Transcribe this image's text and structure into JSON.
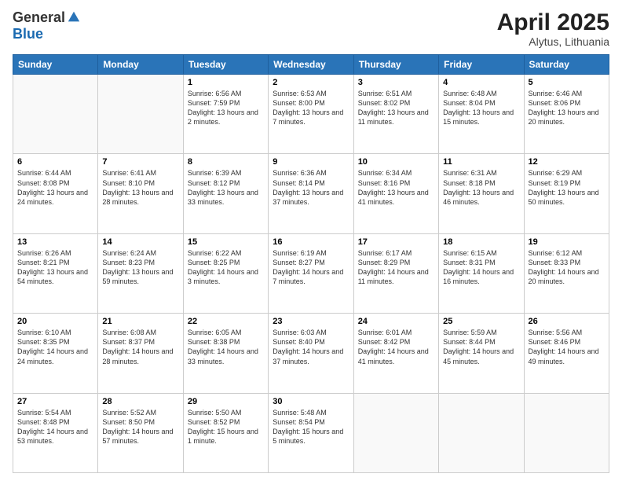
{
  "header": {
    "logo_general": "General",
    "logo_blue": "Blue",
    "title": "April 2025",
    "location": "Alytus, Lithuania"
  },
  "weekdays": [
    "Sunday",
    "Monday",
    "Tuesday",
    "Wednesday",
    "Thursday",
    "Friday",
    "Saturday"
  ],
  "weeks": [
    [
      {
        "day": "",
        "info": ""
      },
      {
        "day": "",
        "info": ""
      },
      {
        "day": "1",
        "info": "Sunrise: 6:56 AM\nSunset: 7:59 PM\nDaylight: 13 hours and 2 minutes."
      },
      {
        "day": "2",
        "info": "Sunrise: 6:53 AM\nSunset: 8:00 PM\nDaylight: 13 hours and 7 minutes."
      },
      {
        "day": "3",
        "info": "Sunrise: 6:51 AM\nSunset: 8:02 PM\nDaylight: 13 hours and 11 minutes."
      },
      {
        "day": "4",
        "info": "Sunrise: 6:48 AM\nSunset: 8:04 PM\nDaylight: 13 hours and 15 minutes."
      },
      {
        "day": "5",
        "info": "Sunrise: 6:46 AM\nSunset: 8:06 PM\nDaylight: 13 hours and 20 minutes."
      }
    ],
    [
      {
        "day": "6",
        "info": "Sunrise: 6:44 AM\nSunset: 8:08 PM\nDaylight: 13 hours and 24 minutes."
      },
      {
        "day": "7",
        "info": "Sunrise: 6:41 AM\nSunset: 8:10 PM\nDaylight: 13 hours and 28 minutes."
      },
      {
        "day": "8",
        "info": "Sunrise: 6:39 AM\nSunset: 8:12 PM\nDaylight: 13 hours and 33 minutes."
      },
      {
        "day": "9",
        "info": "Sunrise: 6:36 AM\nSunset: 8:14 PM\nDaylight: 13 hours and 37 minutes."
      },
      {
        "day": "10",
        "info": "Sunrise: 6:34 AM\nSunset: 8:16 PM\nDaylight: 13 hours and 41 minutes."
      },
      {
        "day": "11",
        "info": "Sunrise: 6:31 AM\nSunset: 8:18 PM\nDaylight: 13 hours and 46 minutes."
      },
      {
        "day": "12",
        "info": "Sunrise: 6:29 AM\nSunset: 8:19 PM\nDaylight: 13 hours and 50 minutes."
      }
    ],
    [
      {
        "day": "13",
        "info": "Sunrise: 6:26 AM\nSunset: 8:21 PM\nDaylight: 13 hours and 54 minutes."
      },
      {
        "day": "14",
        "info": "Sunrise: 6:24 AM\nSunset: 8:23 PM\nDaylight: 13 hours and 59 minutes."
      },
      {
        "day": "15",
        "info": "Sunrise: 6:22 AM\nSunset: 8:25 PM\nDaylight: 14 hours and 3 minutes."
      },
      {
        "day": "16",
        "info": "Sunrise: 6:19 AM\nSunset: 8:27 PM\nDaylight: 14 hours and 7 minutes."
      },
      {
        "day": "17",
        "info": "Sunrise: 6:17 AM\nSunset: 8:29 PM\nDaylight: 14 hours and 11 minutes."
      },
      {
        "day": "18",
        "info": "Sunrise: 6:15 AM\nSunset: 8:31 PM\nDaylight: 14 hours and 16 minutes."
      },
      {
        "day": "19",
        "info": "Sunrise: 6:12 AM\nSunset: 8:33 PM\nDaylight: 14 hours and 20 minutes."
      }
    ],
    [
      {
        "day": "20",
        "info": "Sunrise: 6:10 AM\nSunset: 8:35 PM\nDaylight: 14 hours and 24 minutes."
      },
      {
        "day": "21",
        "info": "Sunrise: 6:08 AM\nSunset: 8:37 PM\nDaylight: 14 hours and 28 minutes."
      },
      {
        "day": "22",
        "info": "Sunrise: 6:05 AM\nSunset: 8:38 PM\nDaylight: 14 hours and 33 minutes."
      },
      {
        "day": "23",
        "info": "Sunrise: 6:03 AM\nSunset: 8:40 PM\nDaylight: 14 hours and 37 minutes."
      },
      {
        "day": "24",
        "info": "Sunrise: 6:01 AM\nSunset: 8:42 PM\nDaylight: 14 hours and 41 minutes."
      },
      {
        "day": "25",
        "info": "Sunrise: 5:59 AM\nSunset: 8:44 PM\nDaylight: 14 hours and 45 minutes."
      },
      {
        "day": "26",
        "info": "Sunrise: 5:56 AM\nSunset: 8:46 PM\nDaylight: 14 hours and 49 minutes."
      }
    ],
    [
      {
        "day": "27",
        "info": "Sunrise: 5:54 AM\nSunset: 8:48 PM\nDaylight: 14 hours and 53 minutes."
      },
      {
        "day": "28",
        "info": "Sunrise: 5:52 AM\nSunset: 8:50 PM\nDaylight: 14 hours and 57 minutes."
      },
      {
        "day": "29",
        "info": "Sunrise: 5:50 AM\nSunset: 8:52 PM\nDaylight: 15 hours and 1 minute."
      },
      {
        "day": "30",
        "info": "Sunrise: 5:48 AM\nSunset: 8:54 PM\nDaylight: 15 hours and 5 minutes."
      },
      {
        "day": "",
        "info": ""
      },
      {
        "day": "",
        "info": ""
      },
      {
        "day": "",
        "info": ""
      }
    ]
  ]
}
